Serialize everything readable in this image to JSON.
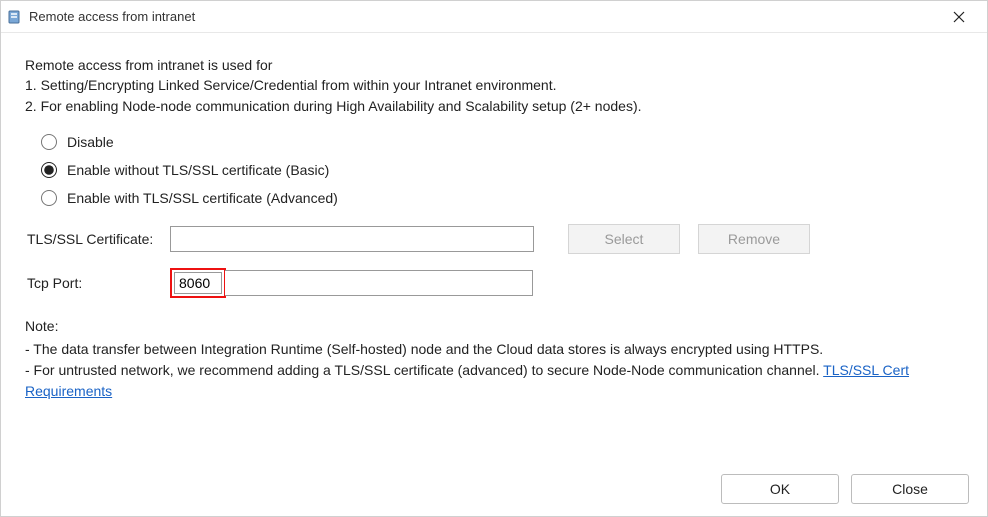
{
  "title": "Remote access from intranet",
  "intro": {
    "lead": "Remote access from intranet is used for",
    "line1": "1. Setting/Encrypting Linked Service/Credential from within your Intranet environment.",
    "line2": "2. For enabling Node-node communication during High Availability and Scalability setup (2+ nodes)."
  },
  "radios": {
    "disable": "Disable",
    "enable_basic": "Enable without TLS/SSL certificate (Basic)",
    "enable_advanced": "Enable with TLS/SSL certificate (Advanced)",
    "selected": "enable_basic"
  },
  "cert": {
    "label": "TLS/SSL Certificate:",
    "value": "",
    "select_btn": "Select",
    "remove_btn": "Remove"
  },
  "port": {
    "label": "Tcp Port:",
    "value": "8060"
  },
  "note": {
    "title": "Note:",
    "line1": " - The data transfer between Integration Runtime (Self-hosted) node and the Cloud data stores is always encrypted using HTTPS.",
    "line2_prefix": " - For untrusted network, we recommend adding a TLS/SSL certificate (advanced) to secure Node-Node communication channel. ",
    "link_text": "TLS/SSL Cert Requirements"
  },
  "footer": {
    "ok": "OK",
    "close": "Close"
  }
}
